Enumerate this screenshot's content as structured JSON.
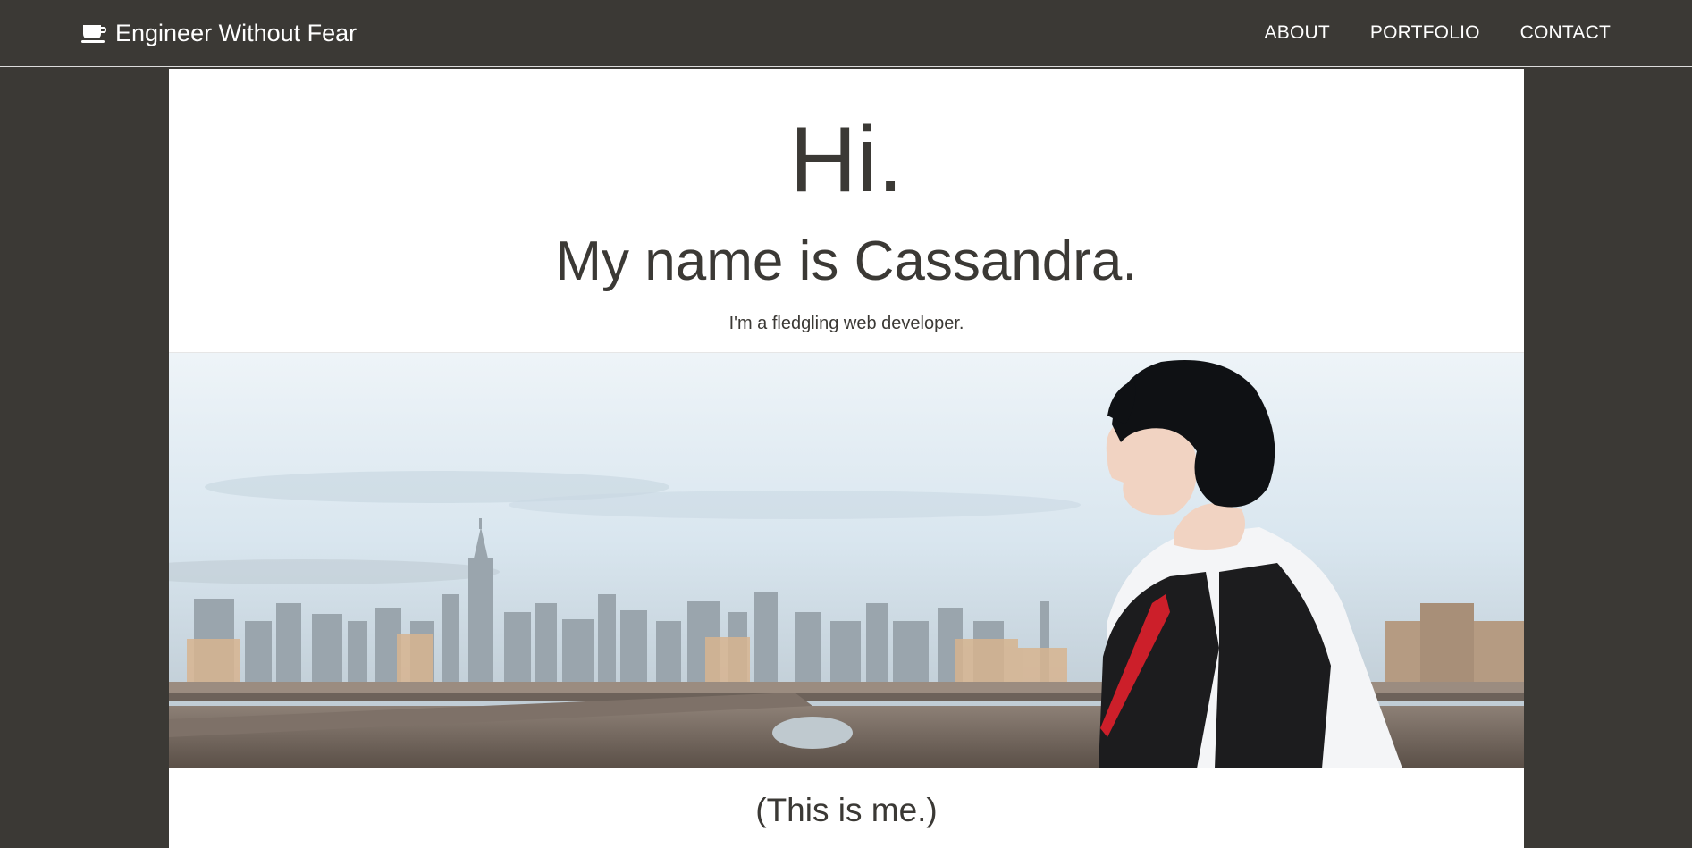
{
  "header": {
    "brand": {
      "icon": "coffee-cup-icon",
      "title": "Engineer Without Fear"
    },
    "nav": [
      {
        "label": "ABOUT"
      },
      {
        "label": "PORTFOLIO"
      },
      {
        "label": "CONTACT"
      }
    ]
  },
  "hero": {
    "greeting": "Hi.",
    "name": "My name is Cassandra.",
    "tagline": "I'm a fledgling web developer."
  },
  "photo": {
    "alt": "Cassandra in profile on a bridge with a city skyline behind her"
  },
  "caption": "(This is me.)",
  "colors": {
    "background": "#3b3935",
    "panel": "#ffffff",
    "text": "#3b3935",
    "nav_text": "#ffffff"
  }
}
